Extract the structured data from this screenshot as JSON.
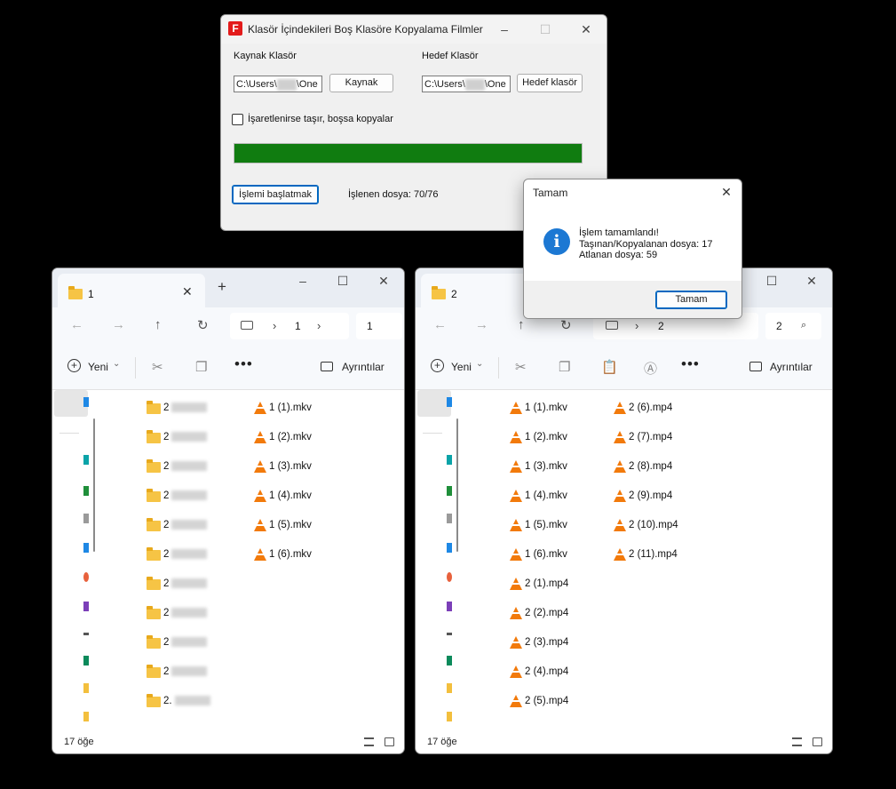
{
  "app": {
    "icon_letter": "F",
    "title": "Klasör İçindekileri Boş Klasöre Kopyalama Filmler",
    "source_label": "Kaynak Klasör",
    "source_path_start": "C:\\Users\\",
    "source_path_end": "\\One",
    "source_button": "Kaynak",
    "target_label": "Hedef Klasör",
    "target_path_start": "C:\\Users\\",
    "target_path_end": "\\One",
    "target_button": "Hedef klasör",
    "move_checkbox_label": "İşaretlenirse taşır, boşsa kopyalar",
    "move_checked": false,
    "progress_fraction": 1.0,
    "progress_color": "#107c10",
    "start_button": "İşlemi başlatmak",
    "processed_text": "İşlenen dosya: 70/76"
  },
  "dialog": {
    "title": "Tamam",
    "line1": "İşlem tamamlandı!",
    "line2": "Taşınan/Kopyalanan dosya: 17",
    "line3": "Atlanan dosya: 59",
    "ok_button": "Tamam",
    "icon": "info-icon"
  },
  "explorer_left": {
    "tab_title": "1",
    "breadcrumb": "1",
    "search_text": "1",
    "new_label": "Yeni",
    "details_label": "Ayrıntılar",
    "status_count": "17 öğe",
    "folders": [
      "2",
      "2",
      "2",
      "2",
      "2",
      "2",
      "2",
      "2",
      "2",
      "2",
      "2."
    ],
    "files": [
      "1 (1).mkv",
      "1 (2).mkv",
      "1 (3).mkv",
      "1 (4).mkv",
      "1 (5).mkv",
      "1 (6).mkv"
    ]
  },
  "explorer_right": {
    "tab_title": "2",
    "breadcrumb": "2",
    "search_text": "2",
    "new_label": "Yeni",
    "details_label": "Ayrıntılar",
    "status_count": "17 öğe",
    "files_col1": [
      "1 (1).mkv",
      "1 (2).mkv",
      "1 (3).mkv",
      "1 (4).mkv",
      "1 (5).mkv",
      "1 (6).mkv",
      "2 (1).mp4",
      "2 (2).mp4",
      "2 (3).mp4",
      "2 (4).mp4",
      "2 (5).mp4"
    ],
    "files_col2": [
      "2 (6).mp4",
      "2 (7).mp4",
      "2 (8).mp4",
      "2 (9).mp4",
      "2 (10).mp4",
      "2 (11).mp4"
    ]
  }
}
